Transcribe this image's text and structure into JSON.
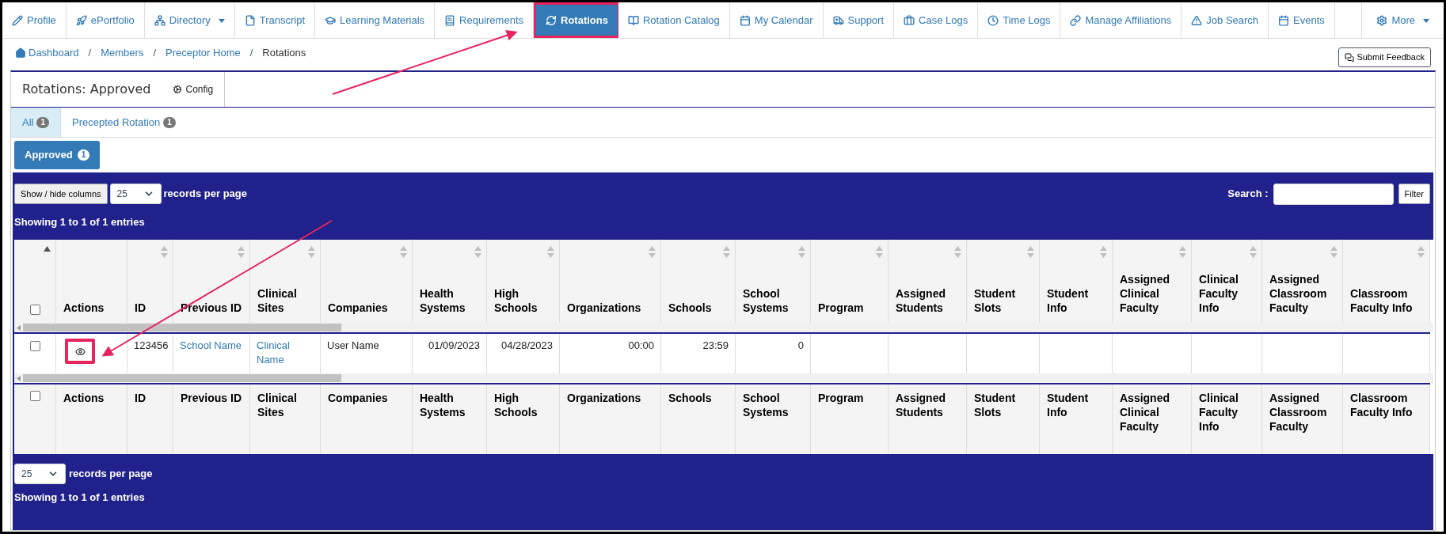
{
  "nav": {
    "items": [
      {
        "label": "Profile",
        "selected": false,
        "highlighted": false,
        "dropdown": false
      },
      {
        "label": "ePortfolio",
        "selected": false,
        "highlighted": false,
        "dropdown": false
      },
      {
        "label": "Directory",
        "selected": false,
        "highlighted": false,
        "dropdown": true
      },
      {
        "label": "Transcript",
        "selected": false,
        "highlighted": false,
        "dropdown": false
      },
      {
        "label": "Learning Materials",
        "selected": false,
        "highlighted": false,
        "dropdown": false
      },
      {
        "label": "Requirements",
        "selected": false,
        "highlighted": false,
        "dropdown": false
      },
      {
        "label": "Rotations",
        "selected": true,
        "highlighted": true,
        "dropdown": false
      },
      {
        "label": "Rotation Catalog",
        "selected": false,
        "highlighted": false,
        "dropdown": false
      },
      {
        "label": "My Calendar",
        "selected": false,
        "highlighted": false,
        "dropdown": false
      },
      {
        "label": "Support",
        "selected": false,
        "highlighted": false,
        "dropdown": false
      },
      {
        "label": "Case Logs",
        "selected": false,
        "highlighted": false,
        "dropdown": false
      },
      {
        "label": "Time Logs",
        "selected": false,
        "highlighted": false,
        "dropdown": false
      },
      {
        "label": "Manage Affiliations",
        "selected": false,
        "highlighted": false,
        "dropdown": false
      },
      {
        "label": "Job Search",
        "selected": false,
        "highlighted": false,
        "dropdown": false
      },
      {
        "label": "Events",
        "selected": false,
        "highlighted": false,
        "dropdown": false
      }
    ],
    "more": {
      "label": "More",
      "dropdown": true
    }
  },
  "breadcrumb": [
    {
      "kind": "link",
      "text": "Dashboard"
    },
    {
      "kind": "separator",
      "text": "/"
    },
    {
      "kind": "link",
      "text": "Members"
    },
    {
      "kind": "separator",
      "text": "/"
    },
    {
      "kind": "link",
      "text": "Preceptor Home"
    },
    {
      "kind": "separator",
      "text": "/"
    },
    {
      "kind": "current",
      "text": "Rotations"
    }
  ],
  "feedback_button": "Submit Feedback",
  "panel": {
    "title": "Rotations: Approved",
    "config": "Config",
    "tabs": [
      {
        "label": "All",
        "count": "1",
        "selected": true
      },
      {
        "label": "Precepted Rotation",
        "count": "1",
        "selected": false
      }
    ],
    "status_button": {
      "label": "Approved",
      "count": "1"
    }
  },
  "table": {
    "show_hide": "Show / hide columns",
    "length": "25",
    "length_label": "records per page",
    "search_label": "Search :",
    "filter": "Filter",
    "info": "Showing 1 to 1 of 1 entries",
    "columns": [
      {
        "kind": "checkbox",
        "checked": false,
        "sortable": true,
        "sorted": true
      },
      {
        "label": "Actions",
        "sortable": false
      },
      {
        "label": "ID",
        "sortable": true,
        "sorted": false
      },
      {
        "label": "Previous ID",
        "sortable": true,
        "sorted": false
      },
      {
        "label": "Clinical Sites",
        "sortable": true,
        "sorted": false
      },
      {
        "label": "Companies",
        "sortable": true,
        "sorted": false
      },
      {
        "label": "Health Systems",
        "sortable": true,
        "sorted": false
      },
      {
        "label": "High Schools",
        "sortable": true,
        "sorted": false
      },
      {
        "label": "Organizations",
        "sortable": true,
        "sorted": false
      },
      {
        "label": "Schools",
        "sortable": true,
        "sorted": false
      },
      {
        "label": "School Systems",
        "sortable": true,
        "sorted": false
      },
      {
        "label": "Program",
        "sortable": true,
        "sorted": false
      },
      {
        "label": "Assigned Students",
        "sortable": true,
        "sorted": false
      },
      {
        "label": "Student Slots",
        "sortable": true,
        "sorted": false
      },
      {
        "label": "Student Info",
        "sortable": true,
        "sorted": false
      },
      {
        "label": "Assigned Clinical Faculty",
        "sortable": true,
        "sorted": false
      },
      {
        "label": "Clinical Faculty Info",
        "sortable": true,
        "sorted": false
      },
      {
        "label": "Assigned Classroom Faculty",
        "sortable": true,
        "sorted": false
      },
      {
        "label": "Classroom Faculty Info",
        "sortable": true,
        "sorted": false
      }
    ],
    "rows": [
      {
        "cells": [
          {
            "kind": "checkbox",
            "checked": false
          },
          {
            "kind": "action",
            "highlighted": true
          },
          {
            "kind": "text",
            "value": "123456"
          },
          {
            "kind": "link",
            "value": "School Name"
          },
          {
            "kind": "link",
            "value": "Clinical Name"
          },
          {
            "kind": "text",
            "value": "User Name"
          },
          {
            "kind": "number",
            "value": "01/09/2023"
          },
          {
            "kind": "number",
            "value": "04/28/2023"
          },
          {
            "kind": "number",
            "value": "00:00"
          },
          {
            "kind": "number",
            "value": "23:59"
          },
          {
            "kind": "number",
            "value": "0"
          }
        ]
      }
    ],
    "footer_columns": [
      {
        "kind": "checkbox",
        "checked": false
      },
      {
        "label": "Actions"
      },
      {
        "label": "ID"
      },
      {
        "label": "Previous ID"
      },
      {
        "label": "Clinical Sites"
      },
      {
        "label": "Companies"
      },
      {
        "label": "Health Systems"
      },
      {
        "label": "High Schools"
      },
      {
        "label": "Organizations"
      },
      {
        "label": "Schools"
      },
      {
        "label": "School Systems"
      },
      {
        "label": "Program"
      },
      {
        "label": "Assigned Students"
      },
      {
        "label": "Student Slots"
      },
      {
        "label": "Student Info"
      },
      {
        "label": "Assigned Clinical Faculty"
      },
      {
        "label": "Clinical Faculty Info"
      },
      {
        "label": "Assigned Classroom Faculty"
      },
      {
        "label": "Classroom Faculty Info"
      }
    ],
    "bottom": {
      "length": "25",
      "length_label": "records per page",
      "info": "Showing 1 to 1 of 1 entries"
    }
  }
}
